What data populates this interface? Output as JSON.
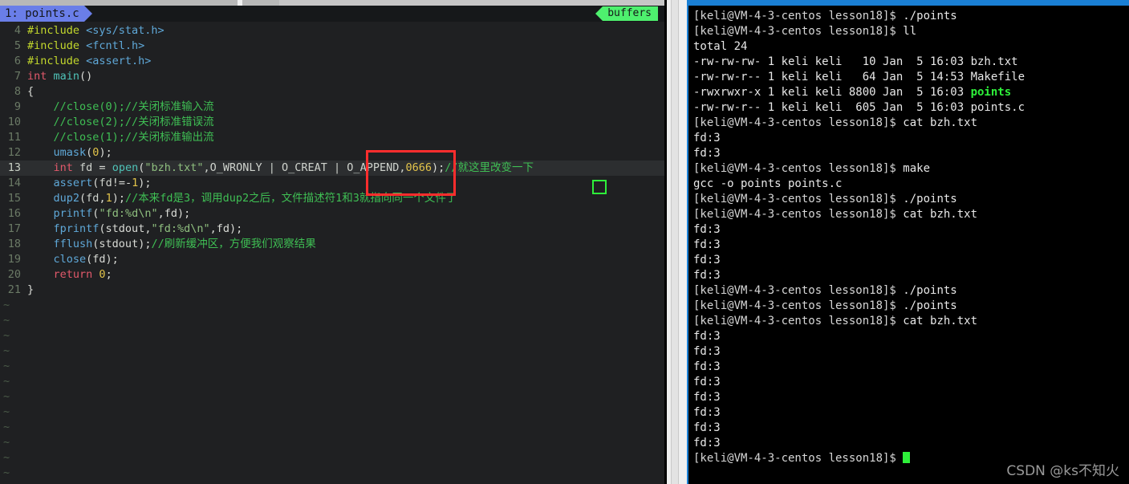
{
  "window": {
    "accent_blue": "#1a7fd4",
    "chrome_gray": "#b8b8b8"
  },
  "editor": {
    "tab_label": "1: points.c",
    "buffers_label": "buffers",
    "cursor_line": 13,
    "tilde_rows": 12,
    "tilde_glyph": "~",
    "annotation": {
      "type": "red-rectangle",
      "color": "#ff2d2d",
      "target_text": "| O_APPEND"
    },
    "cursor_box": {
      "color": "#2ef03a",
      "char": "下"
    },
    "lines": [
      {
        "n": "4",
        "tokens": [
          {
            "t": "#include ",
            "c": "c-pre"
          },
          {
            "t": "<sys/stat.h>",
            "c": "c-hdr"
          }
        ]
      },
      {
        "n": "5",
        "tokens": [
          {
            "t": "#include ",
            "c": "c-pre"
          },
          {
            "t": "<fcntl.h>",
            "c": "c-hdr"
          }
        ]
      },
      {
        "n": "6",
        "tokens": [
          {
            "t": "#include ",
            "c": "c-pre"
          },
          {
            "t": "<assert.h>",
            "c": "c-hdr"
          }
        ]
      },
      {
        "n": "7",
        "tokens": [
          {
            "t": "int ",
            "c": "c-kw"
          },
          {
            "t": "main",
            "c": "c-fn"
          },
          {
            "t": "()",
            "c": "c-punct"
          }
        ]
      },
      {
        "n": "8",
        "tokens": [
          {
            "t": "{",
            "c": "c-punct"
          }
        ]
      },
      {
        "n": "9",
        "tokens": [
          {
            "t": "    //close(0);//关闭标准输入流",
            "c": "c-cmt"
          }
        ]
      },
      {
        "n": "10",
        "tokens": [
          {
            "t": "    //close(2);//关闭标准错误流",
            "c": "c-cmt"
          }
        ]
      },
      {
        "n": "11",
        "tokens": [
          {
            "t": "    //close(1);//关闭标准输出流",
            "c": "c-cmt"
          }
        ]
      },
      {
        "n": "12",
        "tokens": [
          {
            "t": "    ",
            "c": "c-id"
          },
          {
            "t": "umask",
            "c": "c-blue"
          },
          {
            "t": "(",
            "c": "c-punct"
          },
          {
            "t": "0",
            "c": "c-num"
          },
          {
            "t": ");",
            "c": "c-punct"
          }
        ]
      },
      {
        "n": "13",
        "cur": true,
        "tokens": [
          {
            "t": "    ",
            "c": "c-id"
          },
          {
            "t": "int ",
            "c": "c-kw"
          },
          {
            "t": "fd ",
            "c": "c-id"
          },
          {
            "t": "= ",
            "c": "c-punct"
          },
          {
            "t": "open",
            "c": "c-fn"
          },
          {
            "t": "(",
            "c": "c-punct"
          },
          {
            "t": "\"bzh.txt\"",
            "c": "c-str"
          },
          {
            "t": ",O_WRONLY | O_CREAT | O_APPEND,",
            "c": "c-id"
          },
          {
            "t": "0666",
            "c": "c-num"
          },
          {
            "t": ");",
            "c": "c-punct"
          },
          {
            "t": "//就这里改变一下",
            "c": "c-cmt"
          }
        ]
      },
      {
        "n": "14",
        "tokens": [
          {
            "t": "    ",
            "c": "c-id"
          },
          {
            "t": "assert",
            "c": "c-blue"
          },
          {
            "t": "(",
            "c": "c-punct"
          },
          {
            "t": "fd",
            "c": "c-id"
          },
          {
            "t": "!=-",
            "c": "c-punct"
          },
          {
            "t": "1",
            "c": "c-num"
          },
          {
            "t": ");",
            "c": "c-punct"
          }
        ]
      },
      {
        "n": "15",
        "tokens": [
          {
            "t": "    ",
            "c": "c-id"
          },
          {
            "t": "dup2",
            "c": "c-blue"
          },
          {
            "t": "(",
            "c": "c-punct"
          },
          {
            "t": "fd",
            "c": "c-id"
          },
          {
            "t": ",",
            "c": "c-punct"
          },
          {
            "t": "1",
            "c": "c-num"
          },
          {
            "t": ");",
            "c": "c-punct"
          },
          {
            "t": "//本来fd是3，调用dup2之后，文件描述符1和3就指向同一个文件了",
            "c": "c-cmt"
          }
        ]
      },
      {
        "n": "16",
        "tokens": [
          {
            "t": "    ",
            "c": "c-id"
          },
          {
            "t": "printf",
            "c": "c-blue"
          },
          {
            "t": "(",
            "c": "c-punct"
          },
          {
            "t": "\"fd:%d\\n\"",
            "c": "c-str"
          },
          {
            "t": ",fd);",
            "c": "c-punct"
          }
        ]
      },
      {
        "n": "17",
        "tokens": [
          {
            "t": "    ",
            "c": "c-id"
          },
          {
            "t": "fprintf",
            "c": "c-blue"
          },
          {
            "t": "(stdout,",
            "c": "c-punct"
          },
          {
            "t": "\"fd:%d\\n\"",
            "c": "c-str"
          },
          {
            "t": ",fd);",
            "c": "c-punct"
          }
        ]
      },
      {
        "n": "18",
        "tokens": [
          {
            "t": "    ",
            "c": "c-id"
          },
          {
            "t": "fflush",
            "c": "c-blue"
          },
          {
            "t": "(stdout);",
            "c": "c-punct"
          },
          {
            "t": "//刷新缓冲区，方便我们观察结果",
            "c": "c-cmt"
          }
        ]
      },
      {
        "n": "19",
        "tokens": [
          {
            "t": "    ",
            "c": "c-id"
          },
          {
            "t": "close",
            "c": "c-blue"
          },
          {
            "t": "(fd);",
            "c": "c-punct"
          }
        ]
      },
      {
        "n": "20",
        "tokens": [
          {
            "t": "    ",
            "c": "c-id"
          },
          {
            "t": "return ",
            "c": "c-kw"
          },
          {
            "t": "0",
            "c": "c-num"
          },
          {
            "t": ";",
            "c": "c-punct"
          }
        ]
      },
      {
        "n": "21",
        "tokens": [
          {
            "t": "}",
            "c": "c-punct"
          }
        ]
      }
    ]
  },
  "terminal": {
    "prompt": "[keli@VM-4-3-centos lesson18]$ ",
    "cursor_color": "#2ef03a",
    "lines": [
      {
        "segs": [
          {
            "t": "[keli@VM-4-3-centos lesson18]$ ",
            "c": "t-prompt"
          },
          {
            "t": "./points",
            "c": "t-white"
          }
        ]
      },
      {
        "segs": [
          {
            "t": "[keli@VM-4-3-centos lesson18]$ ",
            "c": "t-prompt"
          },
          {
            "t": "ll",
            "c": "t-white"
          }
        ]
      },
      {
        "segs": [
          {
            "t": "total 24",
            "c": "t-white"
          }
        ]
      },
      {
        "segs": [
          {
            "t": "-rw-rw-rw- 1 keli keli   10 Jan  5 16:03 bzh.txt",
            "c": "t-white"
          }
        ]
      },
      {
        "segs": [
          {
            "t": "-rw-rw-r-- 1 keli keli   64 Jan  5 14:53 Makefile",
            "c": "t-white"
          }
        ]
      },
      {
        "segs": [
          {
            "t": "-rwxrwxr-x 1 keli keli 8800 Jan  5 16:03 ",
            "c": "t-white"
          },
          {
            "t": "points",
            "c": "t-green"
          }
        ]
      },
      {
        "segs": [
          {
            "t": "-rw-rw-r-- 1 keli keli  605 Jan  5 16:03 points.c",
            "c": "t-white"
          }
        ]
      },
      {
        "segs": [
          {
            "t": "[keli@VM-4-3-centos lesson18]$ ",
            "c": "t-prompt"
          },
          {
            "t": "cat bzh.txt",
            "c": "t-white"
          }
        ]
      },
      {
        "segs": [
          {
            "t": "fd:3",
            "c": "t-white"
          }
        ]
      },
      {
        "segs": [
          {
            "t": "fd:3",
            "c": "t-white"
          }
        ]
      },
      {
        "segs": [
          {
            "t": "[keli@VM-4-3-centos lesson18]$ ",
            "c": "t-prompt"
          },
          {
            "t": "make",
            "c": "t-white"
          }
        ]
      },
      {
        "segs": [
          {
            "t": "gcc -o points points.c",
            "c": "t-white"
          }
        ]
      },
      {
        "segs": [
          {
            "t": "[keli@VM-4-3-centos lesson18]$ ",
            "c": "t-prompt"
          },
          {
            "t": "./points",
            "c": "t-white"
          }
        ]
      },
      {
        "segs": [
          {
            "t": "[keli@VM-4-3-centos lesson18]$ ",
            "c": "t-prompt"
          },
          {
            "t": "cat bzh.txt",
            "c": "t-white"
          }
        ]
      },
      {
        "segs": [
          {
            "t": "fd:3",
            "c": "t-white"
          }
        ]
      },
      {
        "segs": [
          {
            "t": "fd:3",
            "c": "t-white"
          }
        ]
      },
      {
        "segs": [
          {
            "t": "fd:3",
            "c": "t-white"
          }
        ]
      },
      {
        "segs": [
          {
            "t": "fd:3",
            "c": "t-white"
          }
        ]
      },
      {
        "segs": [
          {
            "t": "[keli@VM-4-3-centos lesson18]$ ",
            "c": "t-prompt"
          },
          {
            "t": "./points",
            "c": "t-white"
          }
        ]
      },
      {
        "segs": [
          {
            "t": "[keli@VM-4-3-centos lesson18]$ ",
            "c": "t-prompt"
          },
          {
            "t": "./points",
            "c": "t-white"
          }
        ]
      },
      {
        "segs": [
          {
            "t": "[keli@VM-4-3-centos lesson18]$ ",
            "c": "t-prompt"
          },
          {
            "t": "cat bzh.txt",
            "c": "t-white"
          }
        ]
      },
      {
        "segs": [
          {
            "t": "fd:3",
            "c": "t-white"
          }
        ]
      },
      {
        "segs": [
          {
            "t": "fd:3",
            "c": "t-white"
          }
        ]
      },
      {
        "segs": [
          {
            "t": "fd:3",
            "c": "t-white"
          }
        ]
      },
      {
        "segs": [
          {
            "t": "fd:3",
            "c": "t-white"
          }
        ]
      },
      {
        "segs": [
          {
            "t": "fd:3",
            "c": "t-white"
          }
        ]
      },
      {
        "segs": [
          {
            "t": "fd:3",
            "c": "t-white"
          }
        ]
      },
      {
        "segs": [
          {
            "t": "fd:3",
            "c": "t-white"
          }
        ]
      },
      {
        "segs": [
          {
            "t": "fd:3",
            "c": "t-white"
          }
        ]
      },
      {
        "segs": [
          {
            "t": "[keli@VM-4-3-centos lesson18]$ ",
            "c": "t-prompt"
          },
          {
            "t": "",
            "c": "t-white",
            "cursor": true
          }
        ]
      }
    ]
  },
  "watermark": {
    "text": "CSDN @ks不知火"
  }
}
